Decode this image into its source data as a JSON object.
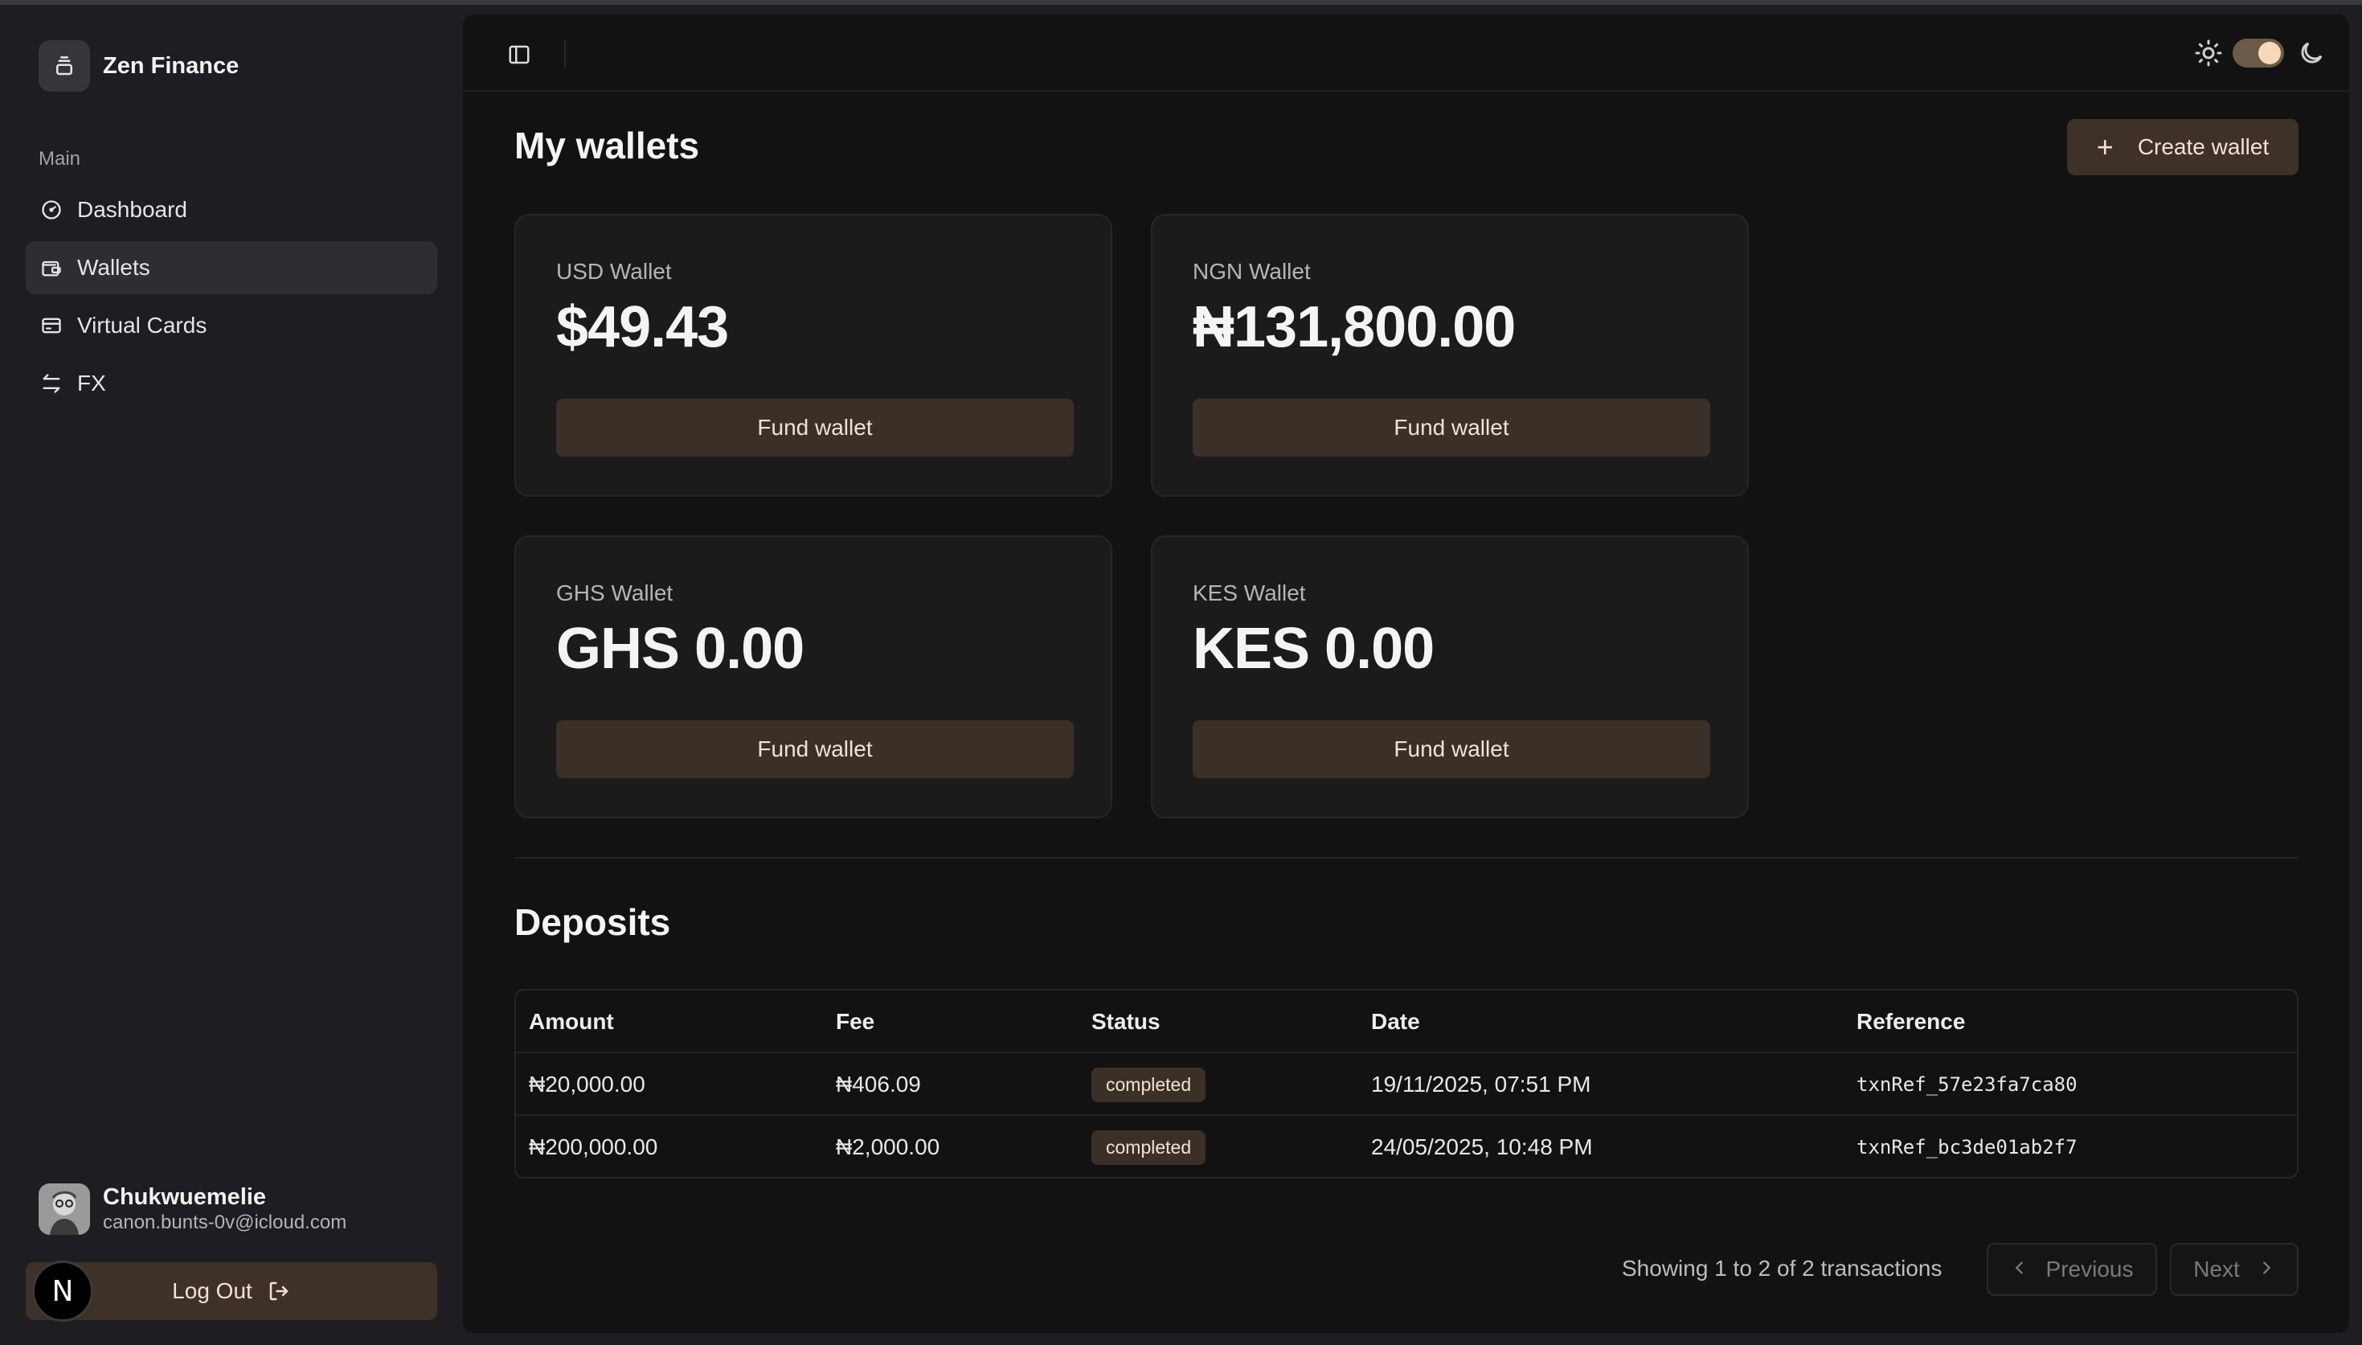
{
  "app": {
    "name": "Zen Finance"
  },
  "sidebar": {
    "section_label": "Main",
    "items": [
      {
        "label": "Dashboard",
        "icon": "gauge-icon"
      },
      {
        "label": "Wallets",
        "icon": "wallet-icon",
        "active": true
      },
      {
        "label": "Virtual Cards",
        "icon": "credit-card-icon"
      },
      {
        "label": "FX",
        "icon": "exchange-icon"
      }
    ],
    "user": {
      "name": "Chukwuemelie",
      "email": "canon.bunts-0v@icloud.com"
    },
    "logout_label": "Log Out",
    "dev_badge": "N"
  },
  "header": {
    "theme": "dark"
  },
  "main": {
    "title": "My wallets",
    "create_label": "Create wallet",
    "wallets": [
      {
        "name": "USD Wallet",
        "balance": "$49.43",
        "action": "Fund wallet"
      },
      {
        "name": "NGN Wallet",
        "balance": "₦131,800.00",
        "action": "Fund wallet"
      },
      {
        "name": "GHS Wallet",
        "balance": "GHS 0.00",
        "action": "Fund wallet"
      },
      {
        "name": "KES Wallet",
        "balance": "KES 0.00",
        "action": "Fund wallet"
      }
    ],
    "deposits": {
      "title": "Deposits",
      "columns": [
        "Amount",
        "Fee",
        "Status",
        "Date",
        "Reference"
      ],
      "rows": [
        {
          "amount": "₦20,000.00",
          "fee": "₦406.09",
          "status": "completed",
          "date": "19/11/2025, 07:51 PM",
          "reference": "txnRef_57e23fa7ca80"
        },
        {
          "amount": "₦200,000.00",
          "fee": "₦2,000.00",
          "status": "completed",
          "date": "24/05/2025, 10:48 PM",
          "reference": "txnRef_bc3de01ab2f7"
        }
      ],
      "pagination": {
        "summary": "Showing 1 to 2 of 2 transactions",
        "previous": "Previous",
        "next": "Next"
      }
    }
  },
  "colors": {
    "accent_button": "#3d3128",
    "accent_text": "#f1e3d4",
    "background": "#121212",
    "sidebar": "#1d1d22"
  }
}
